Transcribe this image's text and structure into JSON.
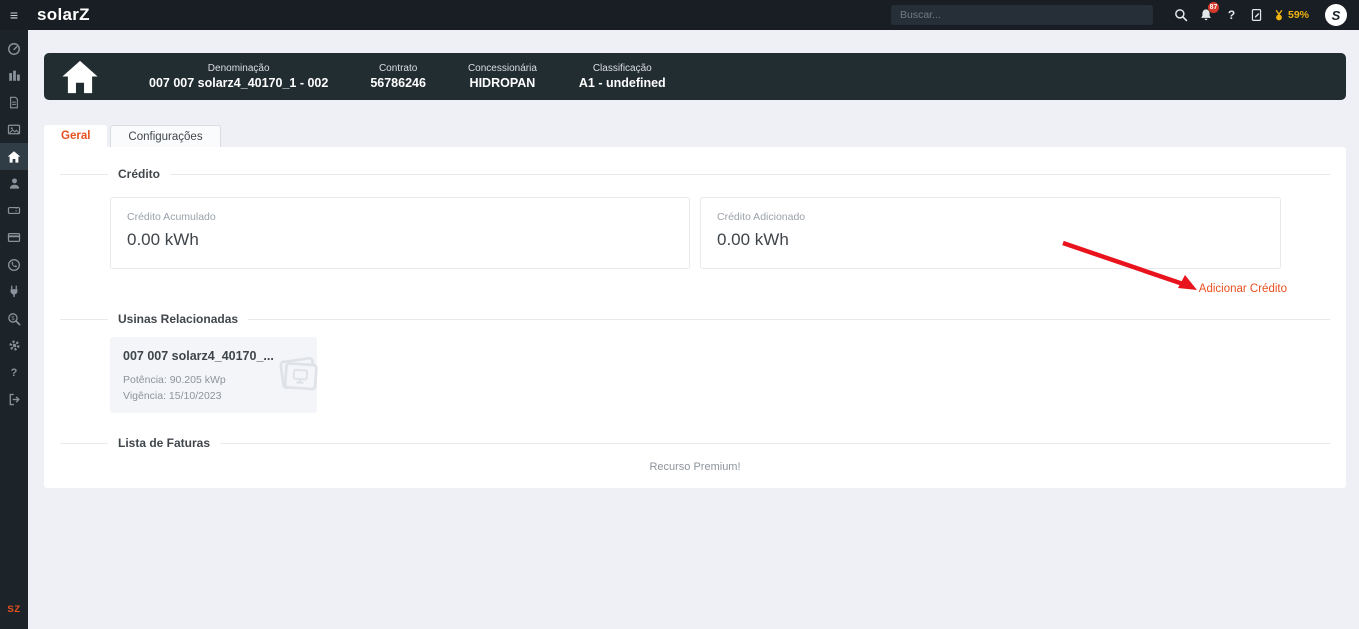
{
  "icons": {
    "menu": "≡",
    "question": "?"
  },
  "navbar": {
    "logo": "solarZ",
    "search_placeholder": "Buscar...",
    "notification_count": "87",
    "level_percent": "59%",
    "avatar_letter": "S"
  },
  "sidebar": {
    "items": [
      {
        "icon": "gauge-icon"
      },
      {
        "icon": "bar-chart-icon"
      },
      {
        "icon": "file-invoice-icon"
      },
      {
        "icon": "photo-icon"
      },
      {
        "icon": "home-icon",
        "active": true
      },
      {
        "icon": "user-icon"
      },
      {
        "icon": "ticket-icon"
      },
      {
        "icon": "credit-card-icon"
      },
      {
        "icon": "whatsapp-icon"
      },
      {
        "icon": "plug-icon"
      },
      {
        "icon": "search-dollar-icon"
      },
      {
        "icon": "gear-icon"
      },
      {
        "icon": "question-icon"
      },
      {
        "icon": "logout-icon"
      }
    ],
    "footer_logo": "SZ"
  },
  "header_card": {
    "fields": [
      {
        "label": "Denominação",
        "value": "007 007 solarz4_40170_1 - 002"
      },
      {
        "label": "Contrato",
        "value": "56786246"
      },
      {
        "label": "Concessionária",
        "value": "HIDROPAN"
      },
      {
        "label": "Classificação",
        "value": "A1 - undefined"
      }
    ]
  },
  "tabs": [
    {
      "label": "Geral",
      "active": true
    },
    {
      "label": "Configurações",
      "active": false
    }
  ],
  "credito": {
    "section_title": "Crédito",
    "cards": [
      {
        "label": "Crédito Acumulado",
        "value": "0.00 kWh"
      },
      {
        "label": "Crédito Adicionado",
        "value": "0.00 kWh"
      }
    ],
    "add_link": "Adicionar Crédito"
  },
  "usinas": {
    "section_title": "Usinas Relacionadas",
    "card": {
      "title": "007 007 solarz4_40170_...",
      "potencia": "Potência: 90.205 kWp",
      "vigencia": "Vigência: 15/10/2023"
    }
  },
  "faturas": {
    "section_title": "Lista de Faturas",
    "empty_message": "Recurso Premium!"
  },
  "colors": {
    "accent": "#e6511f",
    "arrow_red": "#e8131c",
    "gold": "#f0b30f",
    "badge_red": "#d33a2c",
    "dark_header": "#222d32"
  }
}
